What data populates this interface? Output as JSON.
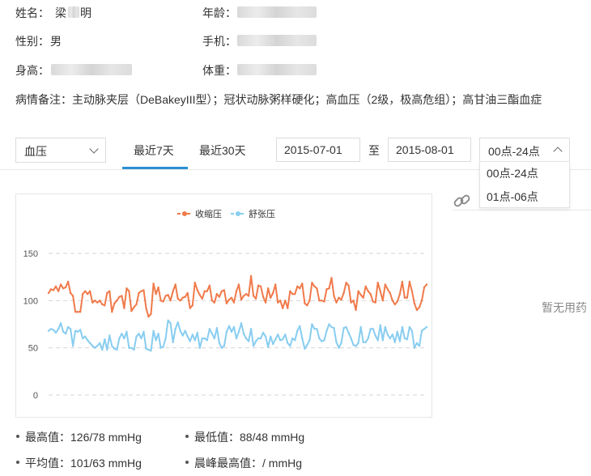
{
  "patient": {
    "name_label": "姓名：",
    "name_first": "梁",
    "name_last": "明",
    "age_label": "年龄：",
    "gender_label": "性别：",
    "gender_value": "男",
    "phone_label": "手机：",
    "height_label": "身高：",
    "weight_label": "体重：",
    "notes_label": "病情备注：",
    "notes_value": "主动脉夹层（DeBakeyIII型）；冠状动脉粥样硬化；高血压（2级，极高危组）；高甘油三酯血症"
  },
  "toolbar": {
    "metric_select": "血压",
    "tabs": [
      "最近7天",
      "最近30天"
    ],
    "active_tab": 0,
    "date_from": "2015-07-01",
    "to_label": "至",
    "date_to": "2015-08-01",
    "time_range": "00点-24点",
    "time_options": [
      "00点-24点",
      "01点-06点"
    ]
  },
  "right_panel": {
    "empty_text": "暂无用药"
  },
  "colors": {
    "systolic": "#f07a4a",
    "diastolic": "#88cdf0",
    "tab_active": "#2a8fd4"
  },
  "chart_data": {
    "type": "line",
    "legend_position": "top-center",
    "ylim": [
      0,
      150
    ],
    "yticks": [
      "0",
      "50",
      "100",
      "150"
    ],
    "grid": true,
    "series": [
      {
        "name": "收缩压",
        "values": [
          108,
          112,
          111,
          115,
          110,
          117,
          113,
          114,
          120,
          108,
          105,
          88,
          88,
          88,
          107,
          110,
          107,
          110,
          98,
          100,
          98,
          100,
          96,
          95,
          108,
          110,
          88,
          97,
          100,
          104,
          105,
          92,
          113,
          110,
          89,
          93,
          96,
          108,
          110,
          111,
          92,
          83,
          86,
          118,
          107,
          114,
          100,
          99,
          105,
          106,
          100,
          110,
          117,
          102,
          100,
          103,
          104,
          108,
          92,
          95,
          119,
          111,
          106,
          102,
          110,
          110,
          116,
          100,
          98,
          107,
          104,
          110,
          111,
          97,
          101,
          103,
          98,
          110,
          117,
          101,
          105,
          107,
          105,
          126,
          105,
          102,
          116,
          115,
          104,
          98,
          113,
          103,
          108,
          117,
          98,
          100,
          92,
          100,
          92,
          110,
          107,
          107,
          115,
          113,
          118,
          97,
          95,
          100,
          119,
          115,
          113,
          100,
          100,
          99,
          112,
          113,
          124,
          105,
          98,
          103,
          101,
          108,
          119,
          116,
          98,
          100,
          90,
          110,
          106,
          103,
          115,
          110,
          107,
          99,
          98,
          119,
          110,
          100,
          117,
          112,
          108,
          100,
          96,
          99,
          107,
          120,
          103,
          103,
          120,
          110,
          97,
          90,
          93,
          100,
          114,
          117
        ]
      },
      {
        "name": "舒张压",
        "values": [
          68,
          70,
          69,
          66,
          70,
          76,
          67,
          65,
          72,
          70,
          52,
          68,
          67,
          69,
          60,
          62,
          58,
          55,
          52,
          50,
          52,
          55,
          48,
          59,
          48,
          63,
          52,
          49,
          48,
          60,
          65,
          60,
          67,
          50,
          50,
          48,
          62,
          65,
          60,
          67,
          49,
          48,
          47,
          68,
          58,
          65,
          50,
          51,
          60,
          79,
          76,
          56,
          70,
          77,
          68,
          63,
          68,
          62,
          57,
          64,
          58,
          66,
          50,
          60,
          60,
          58,
          70,
          65,
          60,
          71,
          55,
          50,
          52,
          67,
          73,
          67,
          72,
          60,
          67,
          76,
          65,
          60,
          57,
          70,
          52,
          57,
          60,
          60,
          66,
          62,
          51,
          62,
          54,
          59,
          64,
          58,
          59,
          64,
          55,
          52,
          60,
          58,
          68,
          73,
          60,
          49,
          53,
          58,
          75,
          70,
          70,
          60,
          57,
          58,
          68,
          75,
          72,
          71,
          56,
          50,
          55,
          71,
          72,
          66,
          60,
          53,
          52,
          55,
          72,
          56,
          56,
          60,
          70,
          70,
          63,
          58,
          74,
          58,
          72,
          64,
          60,
          64,
          56,
          67,
          57,
          72,
          60,
          59,
          72,
          68,
          50,
          55,
          52,
          68,
          70,
          72
        ]
      }
    ]
  },
  "stats": {
    "max_label": "最高值：",
    "max_value": "126/78 mmHg",
    "min_label": "最低值：",
    "min_value": "88/48 mmHg",
    "avg_label": "平均值：",
    "avg_value": "101/63 mmHg",
    "peak_label": "晨峰最高值：",
    "peak_value": "/ mmHg"
  }
}
